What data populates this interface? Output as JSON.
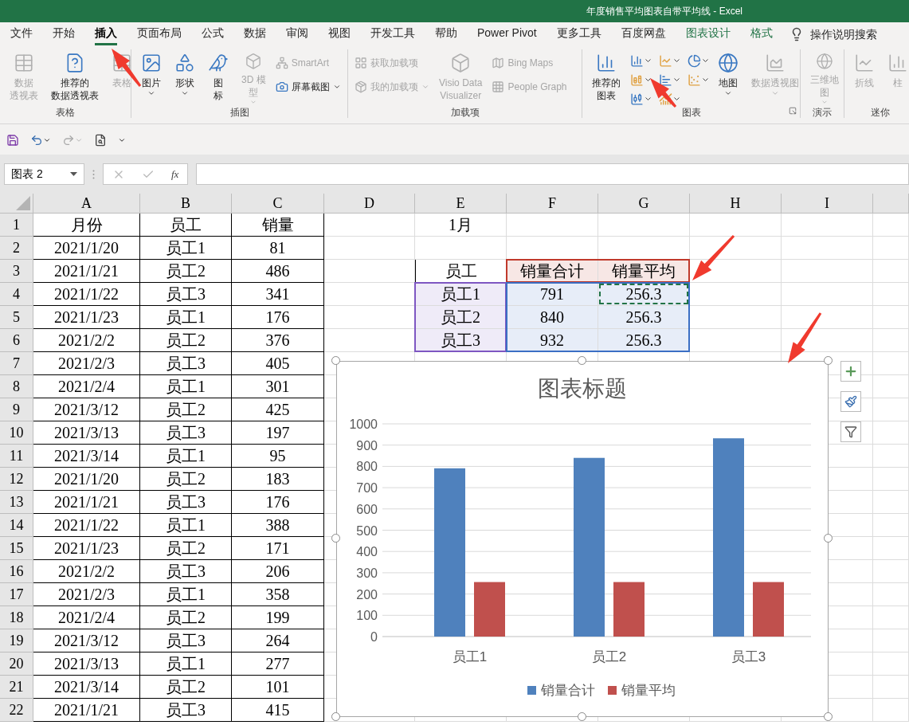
{
  "window": {
    "title": "年度销售平均图表自带平均线  -  Excel"
  },
  "ribbon_tabs": [
    {
      "label": "文件",
      "selected": false,
      "kind": "normal"
    },
    {
      "label": "开始",
      "selected": false,
      "kind": "normal"
    },
    {
      "label": "插入",
      "selected": true,
      "kind": "normal"
    },
    {
      "label": "页面布局",
      "selected": false,
      "kind": "normal"
    },
    {
      "label": "公式",
      "selected": false,
      "kind": "normal"
    },
    {
      "label": "数据",
      "selected": false,
      "kind": "normal"
    },
    {
      "label": "审阅",
      "selected": false,
      "kind": "normal"
    },
    {
      "label": "视图",
      "selected": false,
      "kind": "normal"
    },
    {
      "label": "开发工具",
      "selected": false,
      "kind": "normal"
    },
    {
      "label": "帮助",
      "selected": false,
      "kind": "normal"
    },
    {
      "label": "Power Pivot",
      "selected": false,
      "kind": "normal"
    },
    {
      "label": "更多工具",
      "selected": false,
      "kind": "normal"
    },
    {
      "label": "百度网盘",
      "selected": false,
      "kind": "normal"
    },
    {
      "label": "图表设计",
      "selected": false,
      "kind": "contextual"
    },
    {
      "label": "格式",
      "selected": false,
      "kind": "contextual"
    }
  ],
  "tell_me": {
    "placeholder": "操作说明搜索"
  },
  "ribbon_groups": [
    {
      "label": "表格",
      "items": [
        {
          "kind": "large",
          "lines": [
            "数据",
            "透视表"
          ],
          "disabled": true,
          "dropdown": false
        },
        {
          "kind": "large",
          "lines": [
            "推荐的",
            "数据透视表"
          ],
          "disabled": false,
          "dropdown": false
        },
        {
          "kind": "large",
          "lines": [
            "表格"
          ],
          "disabled": true,
          "dropdown": false
        }
      ]
    },
    {
      "label": "插图",
      "items": [
        {
          "kind": "large",
          "lines": [
            "图片"
          ],
          "disabled": false,
          "dropdown": true
        },
        {
          "kind": "large",
          "lines": [
            "形状"
          ],
          "disabled": false,
          "dropdown": true
        },
        {
          "kind": "large",
          "lines": [
            "图",
            "标"
          ],
          "disabled": false,
          "dropdown": false
        },
        {
          "kind": "large",
          "lines": [
            "3D 模",
            "型"
          ],
          "disabled": true,
          "dropdown": true
        },
        {
          "kind": "small",
          "lines": [
            "SmartArt"
          ],
          "disabled": true,
          "dropdown": false
        },
        {
          "kind": "small",
          "lines": [
            "屏幕截图"
          ],
          "disabled": false,
          "dropdown": true
        }
      ]
    },
    {
      "label": "加载项",
      "items": [
        {
          "kind": "small",
          "lines": [
            "获取加载项"
          ],
          "disabled": true,
          "dropdown": false
        },
        {
          "kind": "small",
          "lines": [
            "我的加载项"
          ],
          "disabled": true,
          "dropdown": true
        },
        {
          "kind": "large",
          "lines": [
            "Visio Data",
            "Visualizer"
          ],
          "disabled": true,
          "dropdown": false
        },
        {
          "kind": "small",
          "lines": [
            "Bing Maps"
          ],
          "disabled": true,
          "dropdown": false
        },
        {
          "kind": "small",
          "lines": [
            "People Graph"
          ],
          "disabled": true,
          "dropdown": false
        }
      ]
    },
    {
      "label": "图表",
      "items": [
        {
          "kind": "large",
          "lines": [
            "推荐的",
            "图表"
          ],
          "disabled": false,
          "dropdown": false
        },
        {
          "kind": "gallery"
        },
        {
          "kind": "large",
          "lines": [
            "地图"
          ],
          "disabled": false,
          "dropdown": true
        },
        {
          "kind": "large",
          "lines": [
            "数据透视图"
          ],
          "disabled": true,
          "dropdown": true
        }
      ]
    },
    {
      "label": "演示",
      "items": [
        {
          "kind": "large",
          "lines": [
            "三维地",
            "图"
          ],
          "disabled": true,
          "dropdown": true
        }
      ]
    },
    {
      "label": "迷你",
      "items": [
        {
          "kind": "large",
          "lines": [
            "折线"
          ],
          "disabled": true,
          "dropdown": false
        },
        {
          "kind": "large",
          "lines": [
            "柱"
          ],
          "disabled": true,
          "dropdown": false
        }
      ]
    }
  ],
  "name_box": {
    "value": "图表 2"
  },
  "formula_bar": {
    "function_label": "fx"
  },
  "sheet": {
    "columns": [
      "A",
      "B",
      "C",
      "D",
      "E",
      "F",
      "G",
      "H",
      "I"
    ],
    "rows": [
      {
        "header": "1",
        "cells": [
          {
            "text": "月份",
            "bordered": true
          },
          {
            "text": "员工",
            "bordered": true
          },
          {
            "text": "销量",
            "bordered": true
          },
          "",
          {
            "text": "1月",
            "bordered": false
          }
        ]
      },
      {
        "header": "2",
        "cells": [
          {
            "text": "2021/1/20",
            "bordered": true
          },
          {
            "text": "员工1",
            "bordered": true
          },
          {
            "text": "81",
            "bordered": true
          }
        ]
      },
      {
        "header": "3",
        "cells": [
          {
            "text": "2021/1/21",
            "bordered": true
          },
          {
            "text": "员工2",
            "bordered": true
          },
          {
            "text": "486",
            "bordered": true
          },
          "",
          {
            "text": "员工",
            "bordered": true
          },
          {
            "text": "销量合计",
            "color": "#c0392b"
          },
          {
            "text": "销量平均",
            "color": "#c0392b"
          }
        ]
      },
      {
        "header": "4",
        "cells": [
          {
            "text": "2021/1/22",
            "bordered": true
          },
          {
            "text": "员工3",
            "bordered": true
          },
          {
            "text": "341",
            "bordered": true
          },
          "",
          {
            "text": "员工1",
            "color": "#7e57c2"
          },
          {
            "text": "791",
            "color": "#3b6fc4"
          },
          {
            "text": "256.3",
            "color": "#3b6fc4",
            "marquee": true
          }
        ]
      },
      {
        "header": "5",
        "cells": [
          {
            "text": "2021/1/23",
            "bordered": true
          },
          {
            "text": "员工1",
            "bordered": true
          },
          {
            "text": "176",
            "bordered": true
          },
          "",
          {
            "text": "员工2",
            "color": "#7e57c2"
          },
          {
            "text": "840",
            "color": "#3b6fc4"
          },
          {
            "text": "256.3",
            "color": "#3b6fc4",
            "marquee": false
          }
        ]
      },
      {
        "header": "6",
        "cells": [
          {
            "text": "2021/2/2",
            "bordered": true
          },
          {
            "text": "员工2",
            "bordered": true
          },
          {
            "text": "376",
            "bordered": true
          },
          "",
          {
            "text": "员工3",
            "color": "#7e57c2"
          },
          {
            "text": "932",
            "color": "#3b6fc4"
          },
          {
            "text": "256.3",
            "color": "#3b6fc4",
            "marquee": false
          }
        ]
      },
      {
        "header": "7",
        "cells": [
          {
            "text": "2021/2/3",
            "bordered": true
          },
          {
            "text": "员工3",
            "bordered": true
          },
          {
            "text": "405",
            "bordered": true
          }
        ]
      },
      {
        "header": "8",
        "cells": [
          {
            "text": "2021/2/4",
            "bordered": true
          },
          {
            "text": "员工1",
            "bordered": true
          },
          {
            "text": "301",
            "bordered": true
          }
        ]
      },
      {
        "header": "9",
        "cells": [
          {
            "text": "2021/3/12",
            "bordered": true
          },
          {
            "text": "员工2",
            "bordered": true
          },
          {
            "text": "425",
            "bordered": true
          }
        ]
      },
      {
        "header": "10",
        "cells": [
          {
            "text": "2021/3/13",
            "bordered": true
          },
          {
            "text": "员工3",
            "bordered": true
          },
          {
            "text": "197",
            "bordered": true
          }
        ]
      },
      {
        "header": "11",
        "cells": [
          {
            "text": "2021/3/14",
            "bordered": true
          },
          {
            "text": "员工1",
            "bordered": true
          },
          {
            "text": "95",
            "bordered": true
          }
        ]
      },
      {
        "header": "12",
        "cells": [
          {
            "text": "2021/1/20",
            "bordered": true
          },
          {
            "text": "员工2",
            "bordered": true
          },
          {
            "text": "183",
            "bordered": true
          }
        ]
      },
      {
        "header": "13",
        "cells": [
          {
            "text": "2021/1/21",
            "bordered": true
          },
          {
            "text": "员工3",
            "bordered": true
          },
          {
            "text": "176",
            "bordered": true
          }
        ]
      },
      {
        "header": "14",
        "cells": [
          {
            "text": "2021/1/22",
            "bordered": true
          },
          {
            "text": "员工1",
            "bordered": true
          },
          {
            "text": "388",
            "bordered": true
          }
        ]
      },
      {
        "header": "15",
        "cells": [
          {
            "text": "2021/1/23",
            "bordered": true
          },
          {
            "text": "员工2",
            "bordered": true
          },
          {
            "text": "171",
            "bordered": true
          }
        ]
      },
      {
        "header": "16",
        "cells": [
          {
            "text": "2021/2/2",
            "bordered": true
          },
          {
            "text": "员工3",
            "bordered": true
          },
          {
            "text": "206",
            "bordered": true
          }
        ]
      },
      {
        "header": "17",
        "cells": [
          {
            "text": "2021/2/3",
            "bordered": true
          },
          {
            "text": "员工1",
            "bordered": true
          },
          {
            "text": "358",
            "bordered": true
          }
        ]
      },
      {
        "header": "18",
        "cells": [
          {
            "text": "2021/2/4",
            "bordered": true
          },
          {
            "text": "员工2",
            "bordered": true
          },
          {
            "text": "199",
            "bordered": true
          }
        ]
      },
      {
        "header": "19",
        "cells": [
          {
            "text": "2021/3/12",
            "bordered": true
          },
          {
            "text": "员工3",
            "bordered": true
          },
          {
            "text": "264",
            "bordered": true
          }
        ]
      },
      {
        "header": "20",
        "cells": [
          {
            "text": "2021/3/13",
            "bordered": true
          },
          {
            "text": "员工1",
            "bordered": true
          },
          {
            "text": "277",
            "bordered": true
          }
        ]
      },
      {
        "header": "21",
        "cells": [
          {
            "text": "2021/3/14",
            "bordered": true
          },
          {
            "text": "员工2",
            "bordered": true
          },
          {
            "text": "101",
            "bordered": true
          }
        ]
      },
      {
        "header": "22",
        "cells": [
          {
            "text": "2021/1/21",
            "bordered": true
          },
          {
            "text": "员工3",
            "bordered": true
          },
          {
            "text": "415",
            "bordered": true
          }
        ]
      }
    ]
  },
  "chart": {
    "chart_data": {
      "type": "bar",
      "title": "图表标题",
      "categories": [
        "员工1",
        "员工2",
        "员工3"
      ],
      "series": [
        {
          "name": "销量合计",
          "color": "#4f81bd",
          "values": [
            791,
            840,
            932
          ]
        },
        {
          "name": "销量平均",
          "color": "#c0504d",
          "values": [
            256.3,
            256.3,
            256.3
          ]
        }
      ],
      "ylim": [
        0,
        1000
      ],
      "yticks": [
        0,
        100,
        200,
        300,
        400,
        500,
        600,
        700,
        800,
        900,
        1000
      ],
      "grid": true
    }
  }
}
